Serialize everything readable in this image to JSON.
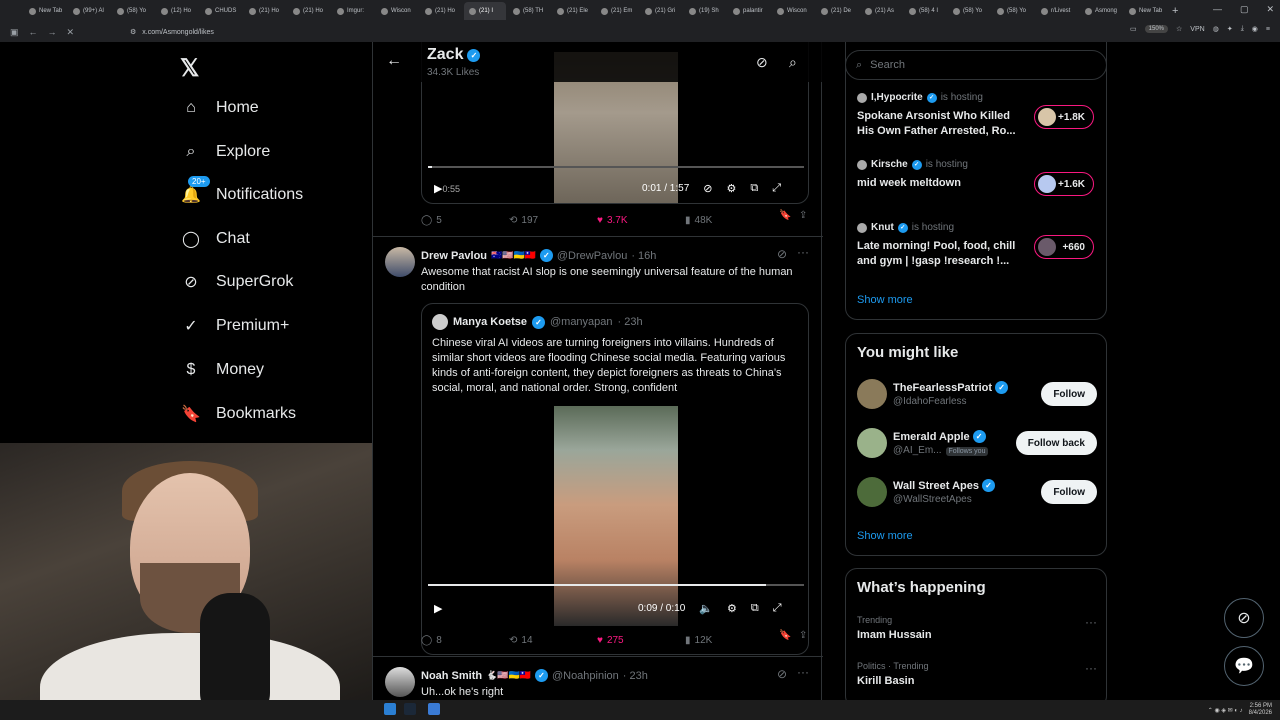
{
  "browser": {
    "tabs": [
      {
        "label": "New Tab"
      },
      {
        "label": "(99+) Al"
      },
      {
        "label": "(58) Yo"
      },
      {
        "label": "(12) Ho"
      },
      {
        "label": "CHUDS"
      },
      {
        "label": "(21) Ho"
      },
      {
        "label": "(21) Ho"
      },
      {
        "label": "Imgur:"
      },
      {
        "label": "Wiscon"
      },
      {
        "label": "(21) Ho"
      },
      {
        "label": "(21) I"
      },
      {
        "label": "(58) TH"
      },
      {
        "label": "(21) Ele"
      },
      {
        "label": "(21) Em"
      },
      {
        "label": "(21) Gri"
      },
      {
        "label": "(19) Sh"
      },
      {
        "label": "palantir"
      },
      {
        "label": "Wiscon"
      },
      {
        "label": "(21) De"
      },
      {
        "label": "(21) As"
      },
      {
        "label": "(58) 4 I"
      },
      {
        "label": "(58) Yo"
      },
      {
        "label": "(58) Yo"
      },
      {
        "label": "r/Livest"
      },
      {
        "label": "Asmong"
      },
      {
        "label": "New Tab"
      }
    ],
    "url": "x.com/Asmongold/likes",
    "zoom": "150%",
    "vpn": "VPN"
  },
  "nav": {
    "items": [
      {
        "label": "Home",
        "icon": "home-icon"
      },
      {
        "label": "Explore",
        "icon": "search-icon"
      },
      {
        "label": "Notifications",
        "icon": "bell-icon",
        "badge": "20+"
      },
      {
        "label": "Chat",
        "icon": "chat-icon"
      },
      {
        "label": "SuperGrok",
        "icon": "grok-icon"
      },
      {
        "label": "Premium+",
        "icon": "premium-icon"
      },
      {
        "label": "Money",
        "icon": "money-icon"
      },
      {
        "label": "Bookmarks",
        "icon": "bookmark-icon"
      }
    ]
  },
  "header": {
    "name": "Zack",
    "likes": "34.3K Likes"
  },
  "top_video": {
    "time_left": "0:55",
    "time": "0:01 / 1:57",
    "progress": 0.01
  },
  "top_actions": {
    "replies": "5",
    "reposts": "197",
    "likes": "3.7K",
    "views": "48K"
  },
  "tweet1": {
    "name": "Drew Pavlou",
    "flags": "🇦🇺🇺🇸🇺🇦🇹🇼",
    "handle": "@DrewPavlou",
    "time": "· 16h",
    "text": "Awesome that racist AI slop is one seemingly universal feature of the human condition",
    "quote": {
      "name": "Manya Koetse",
      "handle": "@manyapan",
      "time": "· 23h",
      "text": "Chinese viral AI videos are turning foreigners into villains. Hundreds of similar short videos are flooding Chinese social media. Featuring various kinds of anti-foreign content, they depict foreigners as threats to China’s social, moral, and national order. Strong, confident"
    },
    "video": {
      "time": "0:09 / 0:10",
      "progress": 0.9
    },
    "actions": {
      "replies": "8",
      "reposts": "14",
      "likes": "275",
      "views": "12K"
    }
  },
  "tweet2": {
    "name": "Noah Smith",
    "flags": "🐇🇺🇸🇺🇦🇹🇼",
    "handle": "@Noahpinion",
    "time": "· 23h",
    "text": "Uh...ok he's right"
  },
  "sidebar": {
    "search_placeholder": "Search",
    "spaces": [
      {
        "host": "I,Hypocrite",
        "status": "is hosting",
        "title": "Spokane Arsonist Who Killed His Own Father Arrested, Ro...",
        "count": "+1.8K"
      },
      {
        "host": "Kirsche",
        "status": "is hosting",
        "title": "mid week meltdown",
        "count": "+1.6K"
      },
      {
        "host": "Knut",
        "status": "is hosting",
        "title": "Late morning! Pool, food, chill and gym | !gasp !research !...",
        "count": "+660"
      }
    ],
    "show_more": "Show more",
    "you_might_like": {
      "title": "You might like",
      "accounts": [
        {
          "name": "TheFearlessPatriot",
          "handle": "@IdahoFearless",
          "button": "Follow"
        },
        {
          "name": "Emerald Apple",
          "handle": "@AI_Em...",
          "follows_you": "Follows you",
          "button": "Follow back"
        },
        {
          "name": "Wall Street Apes",
          "handle": "@WallStreetApes",
          "button": "Follow"
        }
      ],
      "show_more": "Show more"
    },
    "happening": {
      "title": "What’s happening",
      "trends": [
        {
          "category": "Trending",
          "title": "Imam Hussain"
        },
        {
          "category": "Politics · Trending",
          "title": "Kirill Basin"
        }
      ]
    }
  },
  "taskbar": {
    "time": "2:56 PM",
    "date": "8/4/2026"
  }
}
